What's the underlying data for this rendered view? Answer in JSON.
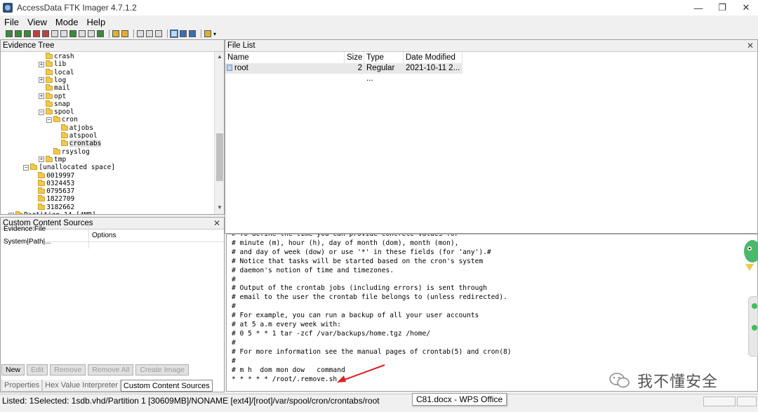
{
  "window": {
    "title": "AccessData FTK Imager 4.7.1.2",
    "controls": [
      "—",
      "❐",
      "✕"
    ]
  },
  "menu": [
    "File",
    "View",
    "Mode",
    "Help"
  ],
  "evidence_tree": {
    "title": "Evidence Tree",
    "items": [
      {
        "label": "crash",
        "depth": 5,
        "exp": "",
        "sel": false
      },
      {
        "label": "lib",
        "depth": 5,
        "exp": "+",
        "sel": false
      },
      {
        "label": "local",
        "depth": 5,
        "exp": "",
        "sel": false
      },
      {
        "label": "log",
        "depth": 5,
        "exp": "+",
        "sel": false
      },
      {
        "label": "mail",
        "depth": 5,
        "exp": "",
        "sel": false
      },
      {
        "label": "opt",
        "depth": 5,
        "exp": "+",
        "sel": false
      },
      {
        "label": "snap",
        "depth": 5,
        "exp": "",
        "sel": false
      },
      {
        "label": "spool",
        "depth": 5,
        "exp": "−",
        "sel": false
      },
      {
        "label": "cron",
        "depth": 6,
        "exp": "−",
        "sel": false
      },
      {
        "label": "atjobs",
        "depth": 7,
        "exp": "",
        "sel": false
      },
      {
        "label": "atspool",
        "depth": 7,
        "exp": "",
        "sel": false
      },
      {
        "label": "crontabs",
        "depth": 7,
        "exp": "",
        "sel": true
      },
      {
        "label": "rsyslog",
        "depth": 6,
        "exp": "",
        "sel": false
      },
      {
        "label": "tmp",
        "depth": 5,
        "exp": "+",
        "sel": false
      },
      {
        "label": "[unallocated space]",
        "depth": 3,
        "exp": "−",
        "sel": false
      },
      {
        "label": "0019997",
        "depth": 4,
        "exp": "",
        "sel": false
      },
      {
        "label": "0324453",
        "depth": 4,
        "exp": "",
        "sel": false
      },
      {
        "label": "0795637",
        "depth": 4,
        "exp": "",
        "sel": false
      },
      {
        "label": "1822709",
        "depth": 4,
        "exp": "",
        "sel": false
      },
      {
        "label": "3182662",
        "depth": 4,
        "exp": "",
        "sel": false
      },
      {
        "label": "Partition 14 [4MB]",
        "depth": 1,
        "exp": "+",
        "sel": false
      }
    ]
  },
  "file_list": {
    "title": "File List",
    "columns": [
      "Name",
      "Size",
      "Type",
      "Date Modified"
    ],
    "rows": [
      {
        "name": "root",
        "size": "2",
        "type": "Regular ...",
        "date": "2021-10-11 2..."
      }
    ]
  },
  "custom_content": {
    "title": "Custom Content Sources",
    "columns": [
      "Evidence:File System|Path|...",
      "Options"
    ],
    "buttons": [
      {
        "label": "New",
        "enabled": true
      },
      {
        "label": "Edit",
        "enabled": false
      },
      {
        "label": "Remove",
        "enabled": false
      },
      {
        "label": "Remove All",
        "enabled": false
      },
      {
        "label": "Create Image",
        "enabled": false
      }
    ]
  },
  "bottom_tabs": [
    {
      "label": "Properties",
      "active": false
    },
    {
      "label": "Hex Value Interpreter",
      "active": false
    },
    {
      "label": "Custom Content Sources",
      "active": true
    }
  ],
  "viewer_lines": [
    "# To define the time you can provide concrete values for",
    "# minute (m), hour (h), day of month (dom), month (mon),",
    "# and day of week (dow) or use '*' in these fields (for 'any').#",
    "# Notice that tasks will be started based on the cron's system",
    "# daemon's notion of time and timezones.",
    "#",
    "# Output of the crontab jobs (including errors) is sent through",
    "# email to the user the crontab file belongs to (unless redirected).",
    "#",
    "# For example, you can run a backup of all your user accounts",
    "# at 5 a.m every week with:",
    "# 0 5 * * 1 tar -zcf /var/backups/home.tgz /home/",
    "#",
    "# For more information see the manual pages of crontab(5) and cron(8)",
    "#",
    "# m h  dom mon dow   command",
    "* * * * * /root/.remove.sh"
  ],
  "status": {
    "text": "Listed: 1Selected: 1sdb.vhd/Partition 1 [30609MB]/NONAME [ext4]/[root]/var/spool/cron/crontabs/root",
    "tooltip": "C81.docx - WPS Office"
  },
  "watermark": {
    "text": "我不懂安全"
  },
  "colors": {
    "accent": "#3b78c0",
    "folder": "#f2c94c",
    "arrow": "#e02020"
  }
}
